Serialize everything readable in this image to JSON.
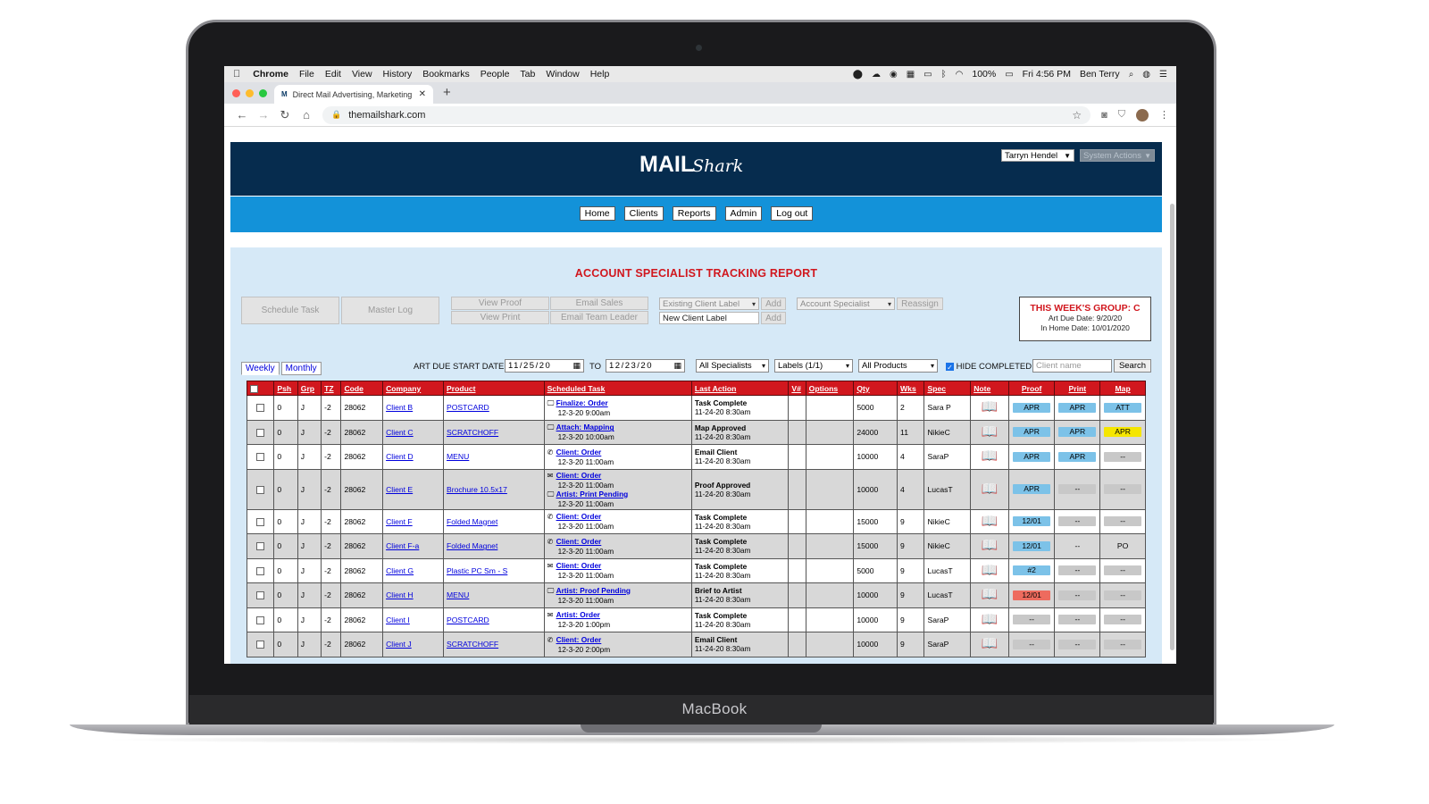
{
  "device": {
    "brand": "MacBook"
  },
  "menubar": {
    "apple": "",
    "items": [
      "Chrome",
      "File",
      "Edit",
      "View",
      "History",
      "Bookmarks",
      "People",
      "Tab",
      "Window",
      "Help"
    ],
    "battery": "100%",
    "clock": "Fri 4:56 PM",
    "user": "Ben Terry"
  },
  "browser": {
    "tab_title": "Direct Mail Advertising, Marketing",
    "url": "themailshark.com"
  },
  "app": {
    "logo_mail": "MAIL",
    "logo_shark": "Shark",
    "user_select": "Tarryn Hendel",
    "system_actions": "System Actions",
    "nav": [
      "Home",
      "Clients",
      "Reports",
      "Admin",
      "Log out"
    ]
  },
  "report": {
    "title": "ACCOUNT SPECIALIST TRACKING REPORT",
    "schedule_task": "Schedule Task",
    "master_log": "Master Log",
    "view_proof": "View Proof",
    "view_print": "View Print",
    "email_sales": "Email Sales",
    "email_team_leader": "Email Team Leader",
    "existing_client_label": "Existing Client Label",
    "new_client_label": "New Client Label",
    "add": "Add",
    "account_specialist": "Account Specialist",
    "reassign": "Reassign",
    "week_group": {
      "title": "THIS WEEK'S GROUP: C",
      "art_due": "Art Due Date: 9/20/20",
      "in_home": "In Home Date: 10/01/2020"
    },
    "view_tabs": [
      "Weekly",
      "Monthly"
    ],
    "art_due_start_label": "ART DUE START DATE",
    "start_date": "11/25/20",
    "to_label": "TO",
    "end_date": "12/23/20",
    "specialists": "All Specialists",
    "labels": "Labels (1/1)",
    "products": "All Products",
    "hide_completed": "HIDE COMPLETED",
    "client_placeholder": "Client name",
    "search": "Search"
  },
  "table": {
    "headers": [
      "",
      "Psh",
      "Grp",
      "TZ",
      "Code",
      "Company",
      "Product",
      "Scheduled Task",
      "Last Action",
      "V#",
      "Options",
      "Qty",
      "Wks",
      "Spec",
      "Note",
      "Proof",
      "Print",
      "Map"
    ],
    "status_colors": {
      "blue": "#7cc2e8",
      "grey": "#c8c8c8",
      "yellow": "#f5e600",
      "red": "#ee6b5e"
    },
    "rows": [
      {
        "psh": "0",
        "grp": "J",
        "tz": "-2",
        "code": "28062",
        "company": "Client B",
        "product": "POSTCARD",
        "tasks": [
          {
            "icon": "monitor-icon",
            "glyph": "🖵",
            "title": "Finalize: Order",
            "date": "12-3-20 9:00am"
          }
        ],
        "last_action": "Task Complete",
        "last_date": "11-24-20 8:30am",
        "v": "",
        "options": "",
        "qty": "5000",
        "wks": "2",
        "spec": "Sara P",
        "proof": {
          "text": "APR",
          "color": "blue"
        },
        "print": {
          "text": "APR",
          "color": "blue"
        },
        "map": {
          "text": "ATT",
          "color": "blue"
        }
      },
      {
        "psh": "0",
        "grp": "J",
        "tz": "-2",
        "code": "28062",
        "company": "Client C",
        "product": "SCRATCHOFF",
        "tasks": [
          {
            "icon": "monitor-icon",
            "glyph": "🖵",
            "title": "Attach: Mapping",
            "date": "12-3-20 10:00am"
          }
        ],
        "last_action": "Map Approved",
        "last_date": "11-24-20 8:30am",
        "v": "",
        "options": "",
        "qty": "24000",
        "wks": "11",
        "spec": "NikieC",
        "proof": {
          "text": "APR",
          "color": "blue"
        },
        "print": {
          "text": "APR",
          "color": "blue"
        },
        "map": {
          "text": "APR",
          "color": "yellow"
        }
      },
      {
        "psh": "0",
        "grp": "J",
        "tz": "-2",
        "code": "28062",
        "company": "Client D",
        "product": "MENU",
        "tasks": [
          {
            "icon": "phone-icon",
            "glyph": "✆",
            "title": "Client: Order",
            "date": "12-3-20 11:00am"
          }
        ],
        "last_action": "Email Client",
        "last_date": "11-24-20 8:30am",
        "v": "",
        "options": "",
        "qty": "10000",
        "wks": "4",
        "spec": "SaraP",
        "proof": {
          "text": "APR",
          "color": "blue"
        },
        "print": {
          "text": "APR",
          "color": "blue"
        },
        "map": {
          "text": "--",
          "color": "grey"
        }
      },
      {
        "psh": "0",
        "grp": "J",
        "tz": "-2",
        "code": "28062",
        "company": "Client E",
        "product": "Brochure 10.5x17",
        "tasks": [
          {
            "icon": "envelope-icon",
            "glyph": "✉",
            "title": "Client: Order",
            "date": "12-3-20 11:00am"
          },
          {
            "icon": "monitor-icon",
            "glyph": "🖵",
            "title": "Artist: Print Pending",
            "date": "12-3-20 11:00am"
          }
        ],
        "last_action": "Proof Approved",
        "last_date": "11-24-20 8:30am",
        "v": "",
        "options": "",
        "qty": "10000",
        "wks": "4",
        "spec": "LucasT",
        "proof": {
          "text": "APR",
          "color": "blue"
        },
        "print": {
          "text": "--",
          "color": "grey"
        },
        "map": {
          "text": "--",
          "color": "grey"
        }
      },
      {
        "psh": "0",
        "grp": "J",
        "tz": "-2",
        "code": "28062",
        "company": "Client F",
        "product": "Folded Magnet",
        "tasks": [
          {
            "icon": "phone-icon",
            "glyph": "✆",
            "title": "Client: Order",
            "date": "12-3-20 11:00am"
          }
        ],
        "last_action": "Task Complete",
        "last_date": "11-24-20 8:30am",
        "v": "",
        "options": "",
        "qty": "15000",
        "wks": "9",
        "spec": "NikieC",
        "proof": {
          "text": "12/01",
          "color": "blue"
        },
        "print": {
          "text": "--",
          "color": "grey"
        },
        "map": {
          "text": "--",
          "color": "grey"
        }
      },
      {
        "psh": "0",
        "grp": "J",
        "tz": "-2",
        "code": "28062",
        "company": "Client F-a",
        "product": "Folded Magnet",
        "tasks": [
          {
            "icon": "phone-icon",
            "glyph": "✆",
            "title": "Client: Order",
            "date": "12-3-20 11:00am"
          }
        ],
        "last_action": "Task Complete",
        "last_date": "11-24-20 8:30am",
        "v": "",
        "options": "",
        "qty": "15000",
        "wks": "9",
        "spec": "NikieC",
        "proof": {
          "text": "12/01",
          "color": "blue"
        },
        "print": {
          "text": "--",
          "color": "none"
        },
        "map": {
          "text": "PO",
          "color": "none"
        }
      },
      {
        "psh": "0",
        "grp": "J",
        "tz": "-2",
        "code": "28062",
        "company": "Client G",
        "product": "Plastic PC Sm - S",
        "tasks": [
          {
            "icon": "envelope-icon",
            "glyph": "✉",
            "title": "Client: Order",
            "date": "12-3-20 11:00am"
          }
        ],
        "last_action": "Task Complete",
        "last_date": "11-24-20 8:30am",
        "v": "",
        "options": "",
        "qty": "5000",
        "wks": "9",
        "spec": "LucasT",
        "proof": {
          "text": "#2",
          "color": "blue"
        },
        "print": {
          "text": "--",
          "color": "grey"
        },
        "map": {
          "text": "--",
          "color": "grey"
        }
      },
      {
        "psh": "0",
        "grp": "J",
        "tz": "-2",
        "code": "28062",
        "company": "Client H",
        "product": "MENU",
        "tasks": [
          {
            "icon": "monitor-icon",
            "glyph": "🖵",
            "title": "Artist: Proof Pending",
            "date": "12-3-20 11:00am"
          }
        ],
        "last_action": "Brief to Artist",
        "last_date": "11-24-20 8:30am",
        "v": "",
        "options": "",
        "qty": "10000",
        "wks": "9",
        "spec": "LucasT",
        "proof": {
          "text": "12/01",
          "color": "red"
        },
        "print": {
          "text": "--",
          "color": "grey"
        },
        "map": {
          "text": "--",
          "color": "grey"
        }
      },
      {
        "psh": "0",
        "grp": "J",
        "tz": "-2",
        "code": "28062",
        "company": "Client I",
        "product": "POSTCARD",
        "tasks": [
          {
            "icon": "envelope-icon",
            "glyph": "✉",
            "title": "Artist: Order",
            "date": "12-3-20 1:00pm"
          }
        ],
        "last_action": "Task Complete",
        "last_date": "11-24-20 8:30am",
        "v": "",
        "options": "",
        "qty": "10000",
        "wks": "9",
        "spec": "SaraP",
        "proof": {
          "text": "--",
          "color": "grey"
        },
        "print": {
          "text": "--",
          "color": "grey"
        },
        "map": {
          "text": "--",
          "color": "grey"
        }
      },
      {
        "psh": "0",
        "grp": "J",
        "tz": "-2",
        "code": "28062",
        "company": "Client J",
        "product": "SCRATCHOFF",
        "tasks": [
          {
            "icon": "phone-icon",
            "glyph": "✆",
            "title": "Client: Order",
            "date": "12-3-20 2:00pm"
          }
        ],
        "last_action": "Email Client",
        "last_date": "11-24-20 8:30am",
        "v": "",
        "options": "",
        "qty": "10000",
        "wks": "9",
        "spec": "SaraP",
        "proof": {
          "text": "--",
          "color": "grey"
        },
        "print": {
          "text": "--",
          "color": "grey"
        },
        "map": {
          "text": "--",
          "color": "grey"
        }
      }
    ]
  }
}
